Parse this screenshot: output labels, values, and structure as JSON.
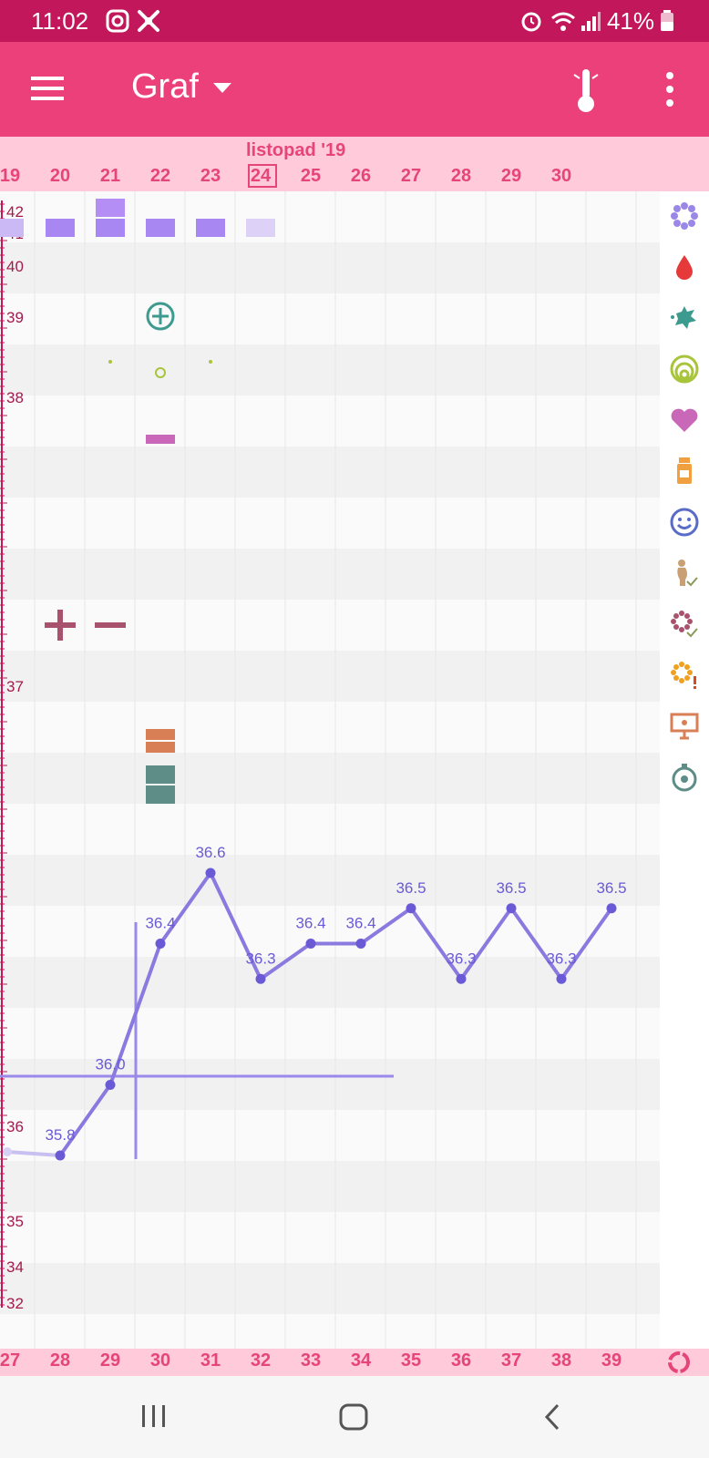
{
  "status_bar": {
    "time": "11:02",
    "battery": "41%"
  },
  "app_bar": {
    "title": "Graf"
  },
  "month_label": "listopad '19",
  "days": [
    "19",
    "20",
    "21",
    "22",
    "23",
    "24",
    "25",
    "26",
    "27",
    "28",
    "29",
    "30"
  ],
  "today": "24",
  "cycle_days": [
    "27",
    "28",
    "29",
    "30",
    "31",
    "32",
    "33",
    "34",
    "35",
    "36",
    "37",
    "38",
    "39"
  ],
  "scale_labels": [
    "42",
    "41",
    "40",
    "39",
    "38",
    "37",
    "36",
    "35",
    "34",
    "32"
  ],
  "colors": {
    "status": "#c2185b",
    "appbar": "#ec407a",
    "strip": "#ffcad9",
    "accent": "#e6457a",
    "line": "#8a7ae0",
    "point": "#6a5ad6"
  },
  "chart_data": {
    "type": "line",
    "x": [
      "28",
      "29",
      "30",
      "31",
      "32",
      "33",
      "34",
      "35",
      "36",
      "37",
      "38",
      "39"
    ],
    "series": [
      {
        "values": [
          35.8,
          36.0,
          36.4,
          36.6,
          36.3,
          36.4,
          36.4,
          36.5,
          36.3,
          36.5,
          36.3,
          36.5
        ]
      }
    ],
    "data_labels": [
      "35.8",
      "36.0",
      "36.4",
      "36.6",
      "36.3",
      "36.4",
      "36.4",
      "36.5",
      "36.3",
      "36.5",
      "36.3",
      "36.5"
    ]
  }
}
